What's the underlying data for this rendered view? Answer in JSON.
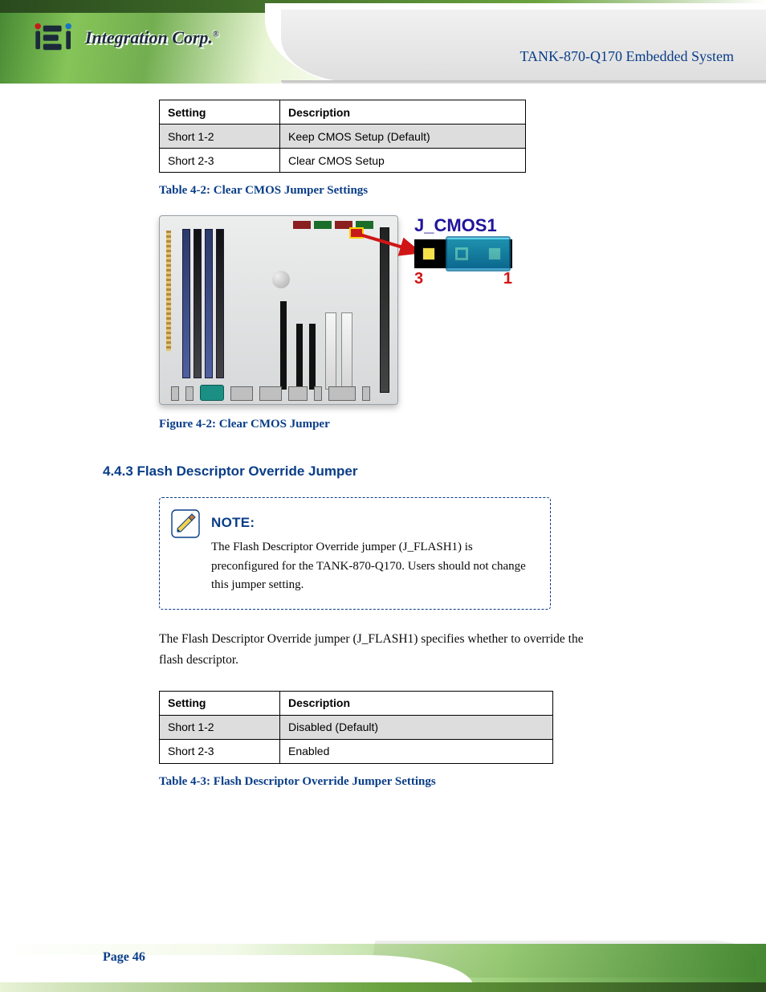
{
  "brand": {
    "name": "Integration Corp.",
    "reg": "®"
  },
  "header_product": "TANK-870-Q170 Embedded System",
  "table1": {
    "headers": [
      "Setting",
      "Description"
    ],
    "rows": [
      {
        "setting": "Short 1-2",
        "desc": "Keep CMOS Setup (Default)"
      },
      {
        "setting": "Short 2-3",
        "desc": "Clear CMOS Setup"
      }
    ],
    "caption": "Table 4-2: Clear CMOS Jumper Settings"
  },
  "figure": {
    "label": "J_CMOS1",
    "pin_left": "3",
    "pin_right": "1",
    "caption": "Figure 4-2: Clear CMOS Jumper"
  },
  "section_h3": "4.4.3 Flash Descriptor Override Jumper",
  "note": {
    "title": "NOTE:",
    "body": "The Flash Descriptor Override jumper (J_FLASH1) is preconfigured for the TANK-870-Q170. Users should not change this jumper setting."
  },
  "paragraph": "The Flash Descriptor Override jumper (J_FLASH1) specifies whether to override the flash descriptor.",
  "table2": {
    "headers": [
      "Setting",
      "Description"
    ],
    "rows": [
      {
        "setting": "Short 1-2",
        "desc": "Disabled (Default)"
      },
      {
        "setting": "Short 2-3",
        "desc": "Enabled"
      }
    ],
    "caption": "Table 4-3: Flash Descriptor Override Jumper Settings"
  },
  "footer_page": "Page 46"
}
